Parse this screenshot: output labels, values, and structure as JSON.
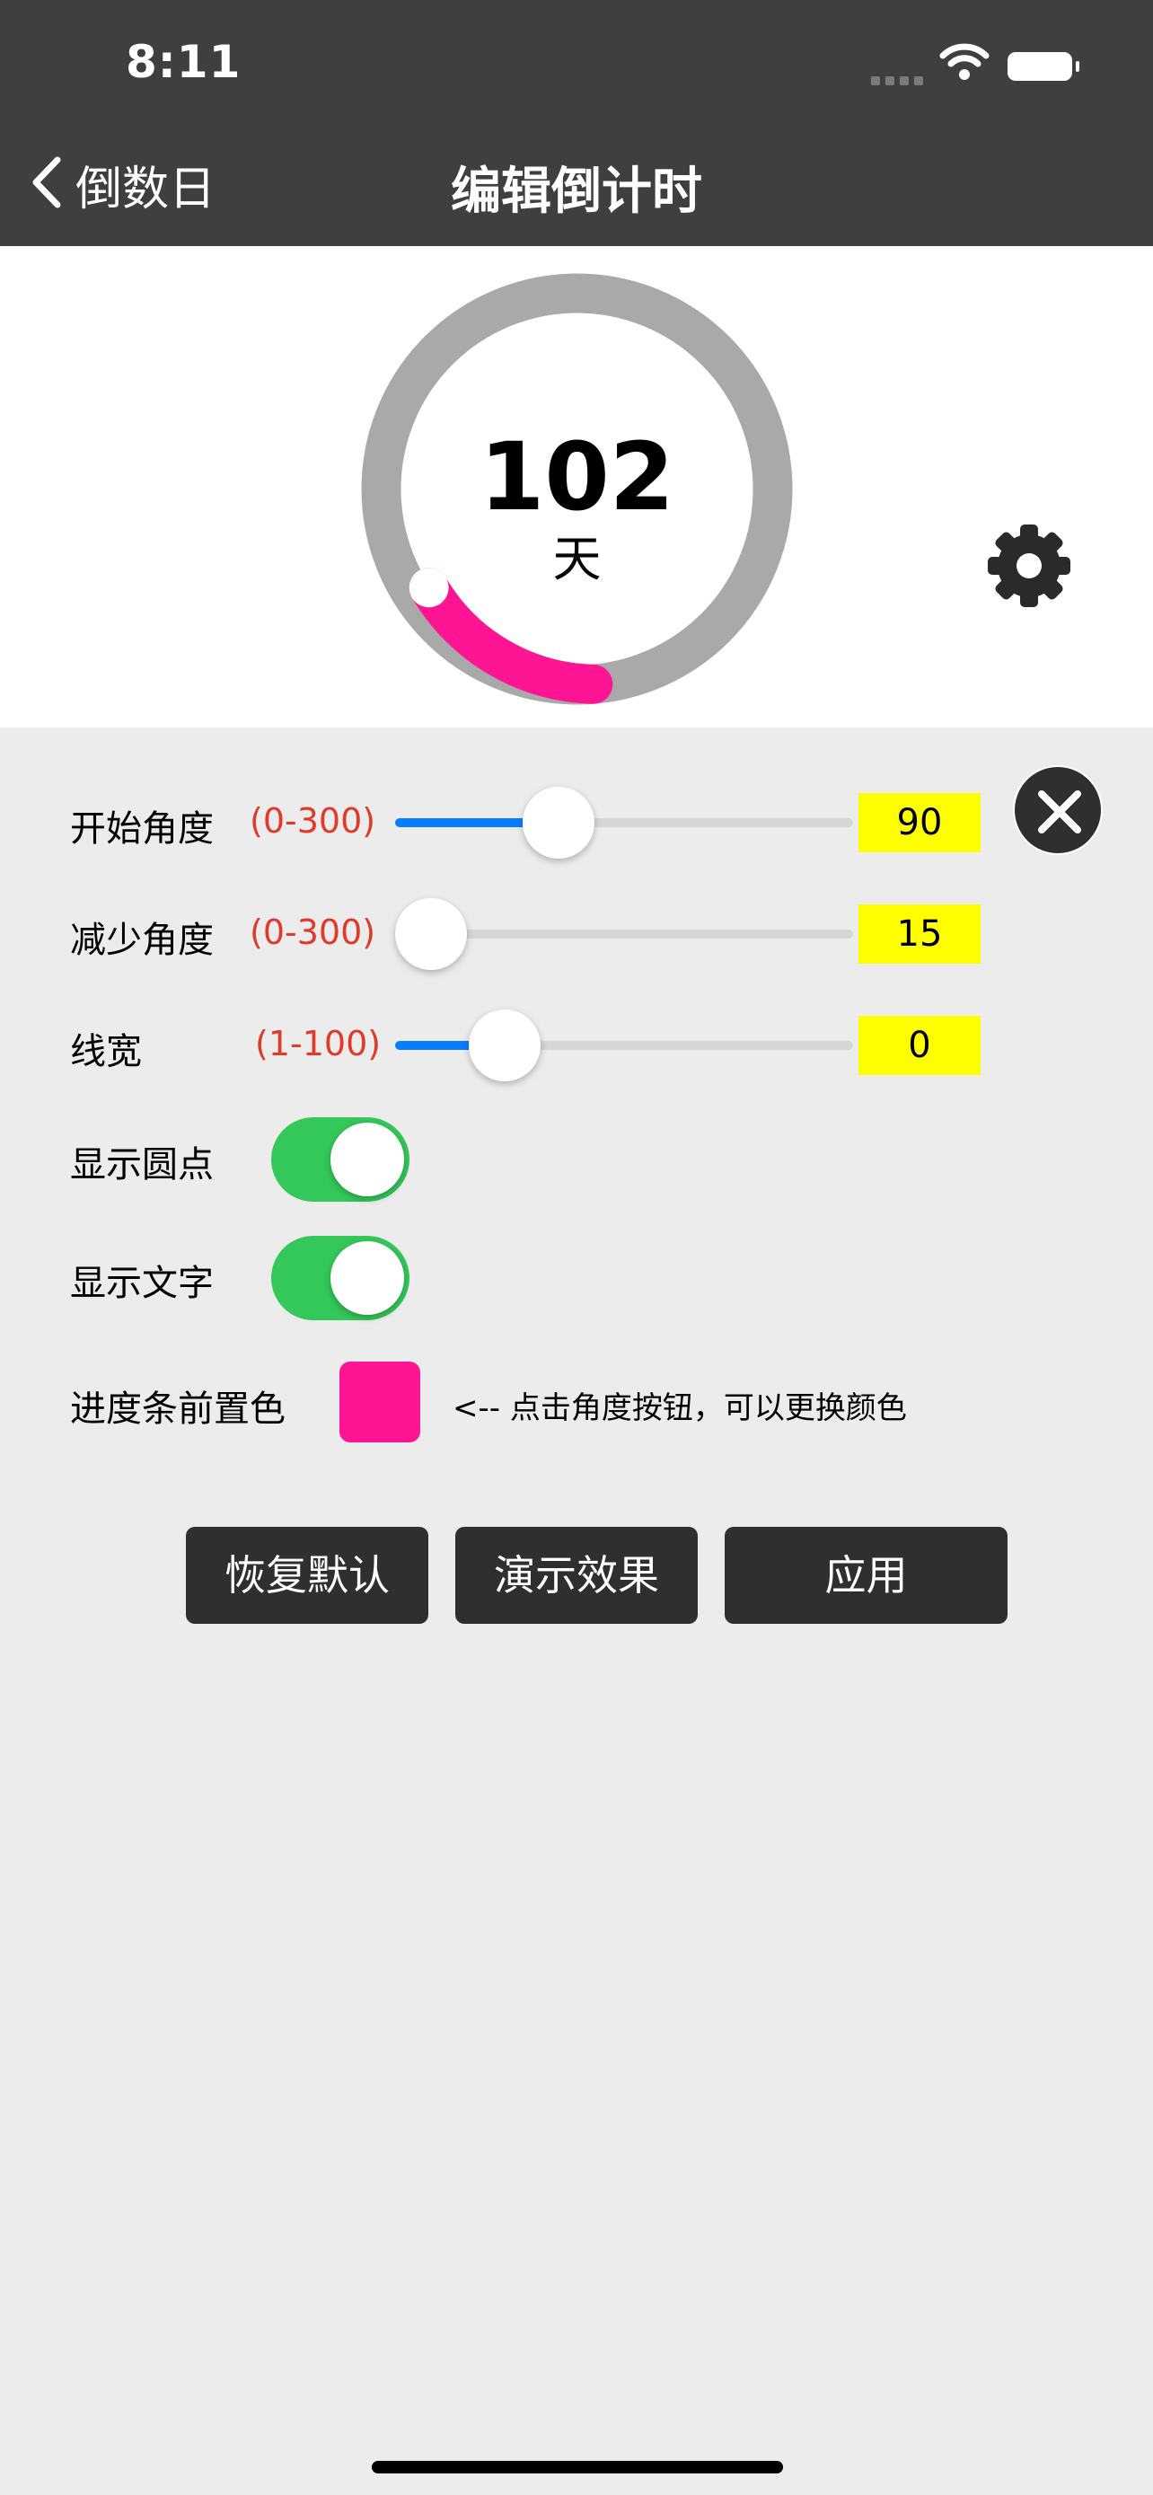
{
  "status_bar": {
    "time": "8:11"
  },
  "nav": {
    "back_label": "倒数日",
    "title": "编辑倒计时"
  },
  "preview": {
    "number": "102",
    "unit": "天",
    "progress_color": "#ff1493",
    "track_color": "#a9a9a9"
  },
  "settings": {
    "start_angle": {
      "label": "开始角度",
      "range": "(0-300)",
      "value": "90",
      "slider_fraction": 0.33
    },
    "reduce_angle": {
      "label": "减少角度",
      "range": "(0-300)",
      "value": "15",
      "slider_fraction": 0.0
    },
    "line_width": {
      "label": "线宽",
      "range": "(1-100)",
      "value": "0",
      "slider_fraction": 0.19
    },
    "show_dot": {
      "label": "显示圆点",
      "on": true
    },
    "show_text": {
      "label": "显示文字",
      "on": true
    },
    "progress_color": {
      "label": "进度条前置色",
      "color": "#ff1493",
      "hint": "<-- 点击角度按钮，可以更换颜色"
    }
  },
  "actions": {
    "reset": "恢复默认",
    "demo": "演示效果",
    "apply": "应用"
  },
  "colors": {
    "header_bg": "#3f3f3f",
    "panel_bg": "#ececec",
    "slider_blue": "#0a7cff",
    "toggle_green": "#34c759",
    "value_box": "#ffff00"
  }
}
